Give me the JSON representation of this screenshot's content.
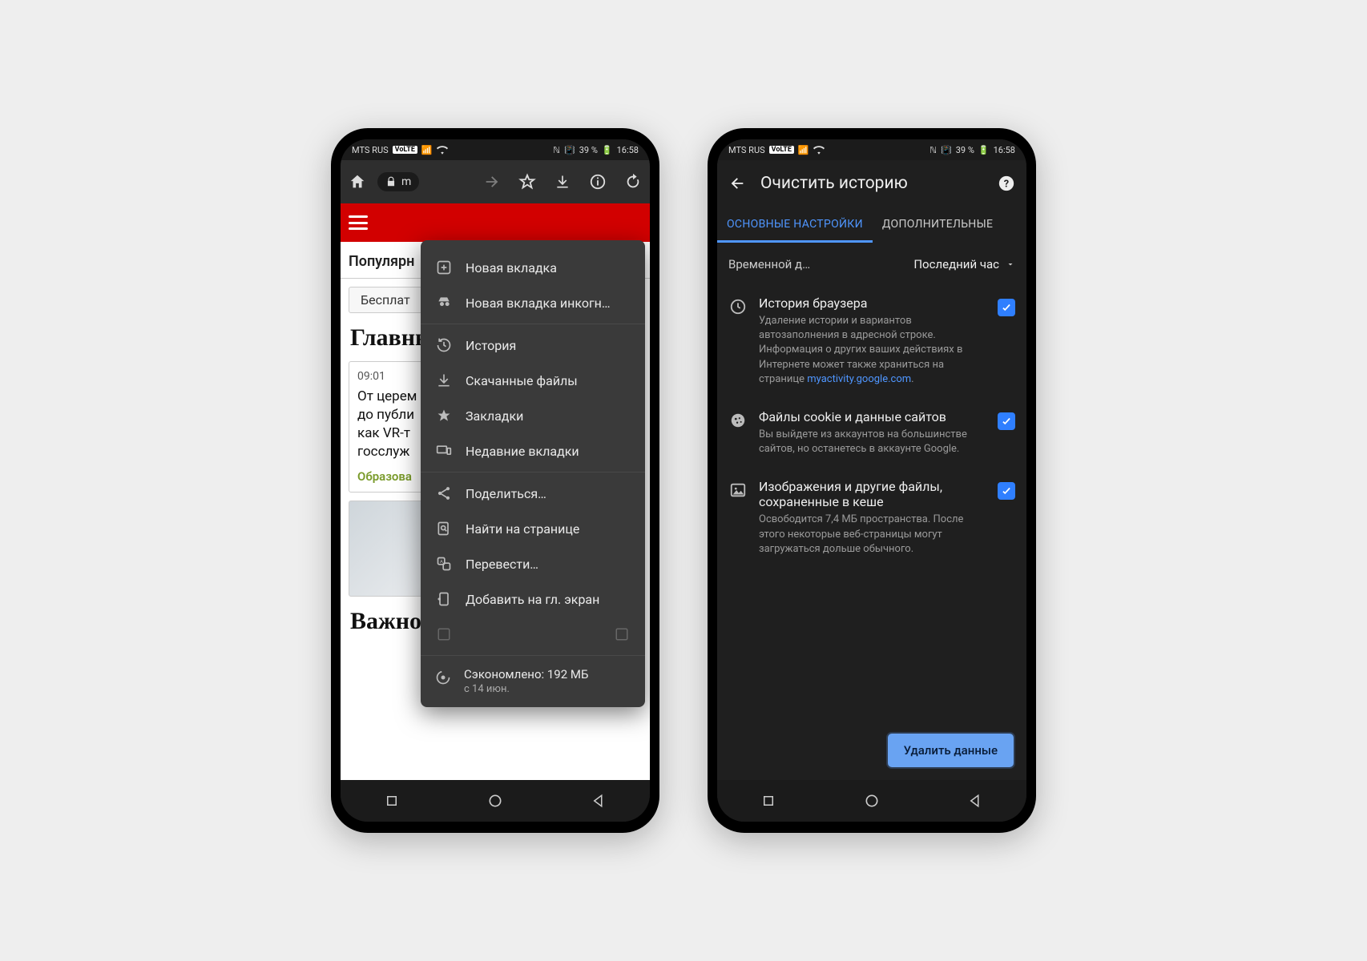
{
  "status": {
    "carrier": "MTS RUS",
    "volte": "VoLTE",
    "battery_pct": "39 %",
    "time": "16:58"
  },
  "phone1": {
    "toolbar": {
      "url_fragment": "m"
    },
    "page": {
      "tab_label": "Популярн",
      "pill": "Бесплат",
      "heading": "Главнь",
      "article": {
        "time": "09:01",
        "title_l1": "От церем",
        "title_l2": "до публи",
        "title_l3": "как VR-т",
        "title_l4": "госслуж",
        "category": "Образова"
      },
      "section2": "Важное"
    },
    "menu": {
      "new_tab": "Новая вкладка",
      "new_incognito": "Новая вкладка инкогн…",
      "history": "История",
      "downloads": "Скачанные файлы",
      "bookmarks": "Закладки",
      "recent_tabs": "Недавние вкладки",
      "share": "Поделиться…",
      "find": "Найти на странице",
      "translate": "Перевести…",
      "add_home": "Добавить на гл. экран",
      "saved_line": "Сэкономлено: 192 МБ",
      "saved_sub": "с 14 июн."
    }
  },
  "phone2": {
    "title": "Очистить историю",
    "tabs": {
      "basic": "ОСНОВНЫЕ НАСТРОЙКИ",
      "advanced": "ДОПОЛНИТЕЛЬНЫЕ"
    },
    "range": {
      "label": "Временной д…",
      "value": "Последний час"
    },
    "opts": {
      "history": {
        "title": "История браузера",
        "desc": "Удаление истории и вариантов автозаполнения в адресной строке. Информация о других ваших действиях в Интернете может также храниться на странице ",
        "link": "myactivity.google.com"
      },
      "cookies": {
        "title": "Файлы cookie и данные сайтов",
        "desc": "Вы выйдете из аккаунтов на большинстве сайтов, но останетесь в аккаунте Google."
      },
      "cache": {
        "title": "Изображения и другие файлы, сохраненные в кеше",
        "desc": "Освободится 7,4 МБ пространства. После этого некоторые веб-страницы могут загружаться дольше обычного."
      }
    },
    "delete_button": "Удалить данные"
  }
}
